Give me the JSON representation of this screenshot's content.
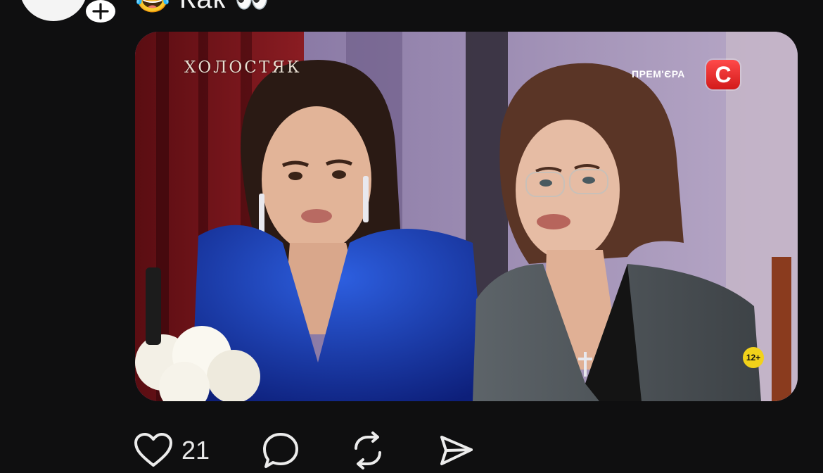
{
  "post": {
    "caption": "😂 Как 👀",
    "media": {
      "show_logo": "ХОЛОСТЯК",
      "premiere_label": "ПРЕМ'ЄРА",
      "channel_logo": "С",
      "age_rating": "12+"
    },
    "actions": {
      "like_count": "21",
      "icons": [
        "heart-icon",
        "comment-icon",
        "repost-icon",
        "share-icon"
      ]
    }
  },
  "colors": {
    "background": "#0f0f10",
    "text": "#f2f2f2",
    "channel_red": "#e02626",
    "badge_yellow": "#f2d21a"
  }
}
